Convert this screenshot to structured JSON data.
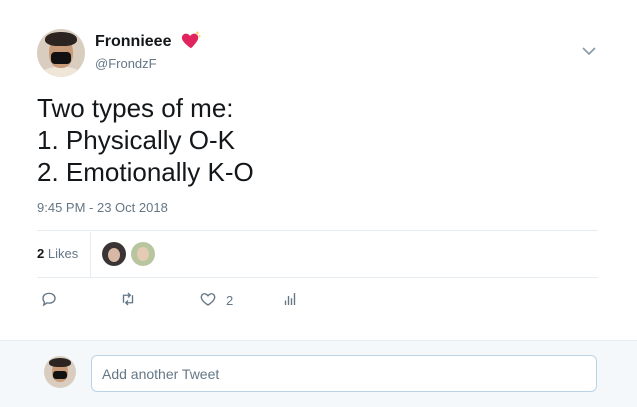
{
  "tweet": {
    "author_name": "Fronnieee",
    "author_handle": "@FrondzF",
    "text": "Two types of me:\n1. Physically O-K\n2. Emotionally K-O",
    "timestamp": "9:45 PM - 23 Oct 2018",
    "likes_count": "2",
    "likes_label": "Likes"
  },
  "actions": {
    "reply_icon": "reply-icon",
    "retweet_icon": "retweet-icon",
    "like_icon": "heart-icon",
    "like_count": "2",
    "analytics_icon": "analytics-icon"
  },
  "reply": {
    "placeholder": "Add another Tweet"
  },
  "colors": {
    "text_primary": "#14171a",
    "text_secondary": "#657786",
    "divider": "#e6ecf0",
    "reply_bar_bg": "#f5f8fa",
    "heart_emoji": "#e0245e"
  }
}
